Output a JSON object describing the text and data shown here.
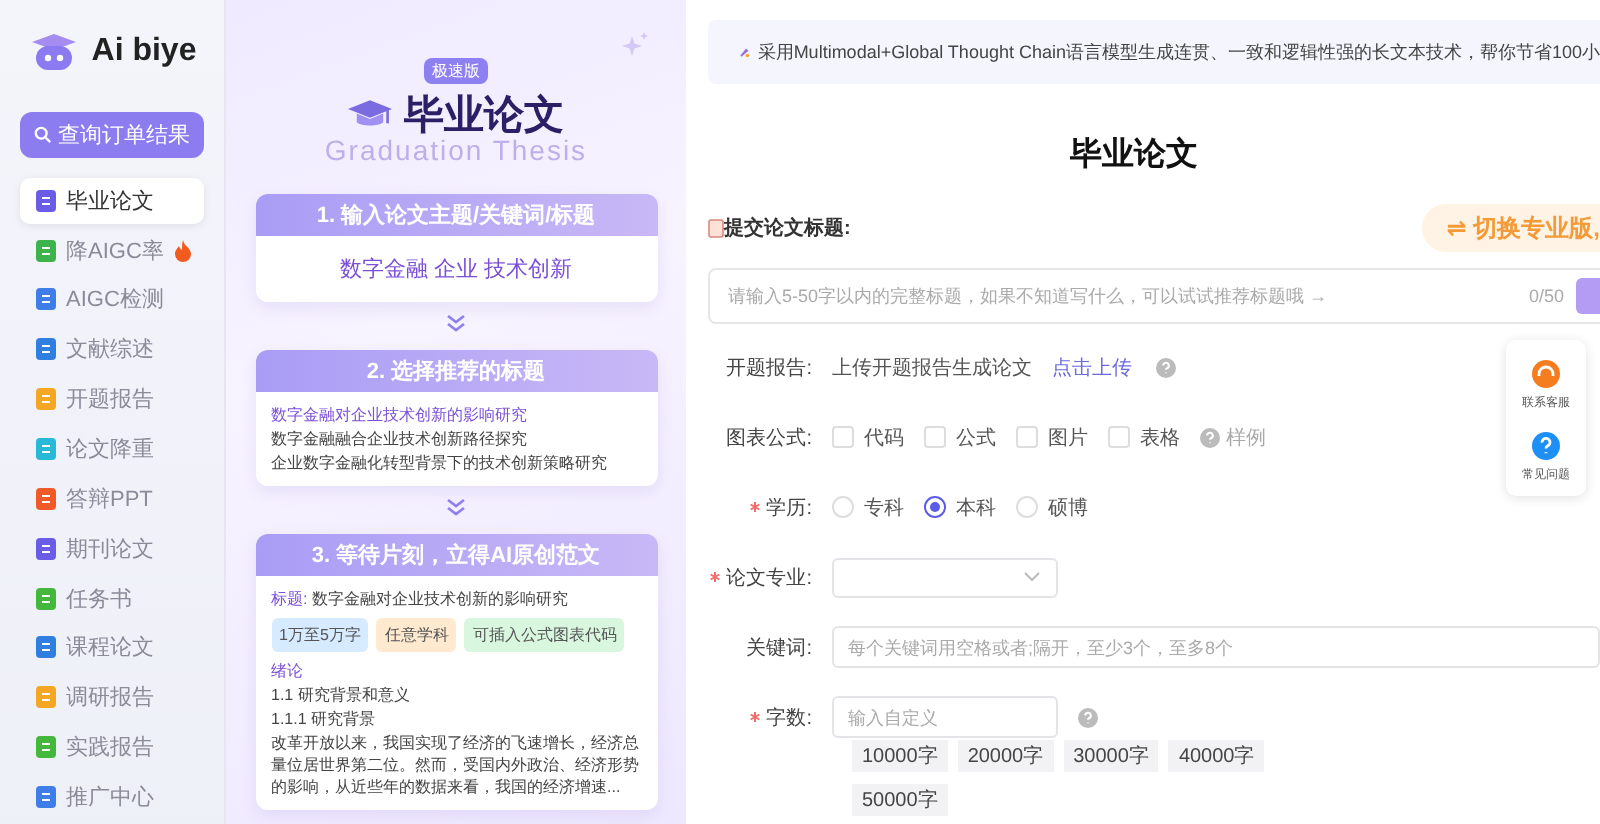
{
  "brand": {
    "name": "Ai biye"
  },
  "sidebar": {
    "search_button": "查询订单结果",
    "items": [
      {
        "label": "毕业论文",
        "selected": true,
        "color": "#6b5ce7",
        "hot": false
      },
      {
        "label": "降AIGC率",
        "selected": false,
        "color": "#3cb44b",
        "hot": true
      },
      {
        "label": "AIGC检测",
        "selected": false,
        "color": "#3f7de8",
        "hot": false
      },
      {
        "label": "文献综述",
        "selected": false,
        "color": "#2f7fe0",
        "hot": false
      },
      {
        "label": "开题报告",
        "selected": false,
        "color": "#f5a623",
        "hot": false
      },
      {
        "label": "论文降重",
        "selected": false,
        "color": "#28b8d8",
        "hot": false
      },
      {
        "label": "答辩PPT",
        "selected": false,
        "color": "#ef5a28",
        "hot": false
      },
      {
        "label": "期刊论文",
        "selected": false,
        "color": "#6b5ce7",
        "hot": false
      },
      {
        "label": "任务书",
        "selected": false,
        "color": "#43b83c",
        "hot": false
      },
      {
        "label": "课程论文",
        "selected": false,
        "color": "#2f7fe0",
        "hot": false
      },
      {
        "label": "调研报告",
        "selected": false,
        "color": "#f5a623",
        "hot": false
      },
      {
        "label": "实践报告",
        "selected": false,
        "color": "#43b83c",
        "hot": false
      },
      {
        "label": "推广中心",
        "selected": false,
        "color": "#3f7de8",
        "hot": false
      }
    ]
  },
  "promo": {
    "badge": "极速版",
    "title": "毕业论文",
    "subtitle": "Graduation Thesis",
    "steps": [
      {
        "kind": "keywords",
        "header": "1. 输入论文主题/关键词/标题",
        "text": "数字金融 企业 技术创新"
      },
      {
        "kind": "titles",
        "header": "2. 选择推荐的标题",
        "lines": [
          {
            "text": "数字金融对企业技术创新的影响研究",
            "selected": true
          },
          {
            "text": "数字金融融合企业技术创新路径探究",
            "selected": false
          },
          {
            "text": "企业数字金融化转型背景下的技术创新策略研究",
            "selected": false
          }
        ]
      },
      {
        "kind": "sample",
        "header": "3. 等待片刻，立得AI原创范文",
        "title_label": "标题:",
        "title": "数字金融对企业技术创新的影响研究",
        "tags": [
          {
            "text": "1万至5万字",
            "color": "#d6ebff"
          },
          {
            "text": "任意学科",
            "color": "#ffe9cf"
          },
          {
            "text": "可插入公式图表代码",
            "color": "#d9f7df"
          }
        ],
        "section": "绪论",
        "lines": [
          "1.1 研究背景和意义",
          "1.1.1 研究背景"
        ],
        "paragraph": "改革开放以来，我国实现了经济的飞速增长，经济总量位居世界第二位。然而，受国内外政治、经济形势的影响，从近些年的数据来看，我国的经济增速..."
      }
    ]
  },
  "main": {
    "banner": "采用Multimodal+Global Thought Chain语言模型生成连贯、一致和逻辑性强的长文本技术，帮你节省100小",
    "title": "毕业论文",
    "title_label": "提交论文标题:",
    "switch_button": "⇌ 切换专业版,",
    "title_input": {
      "placeholder": "请输入5-50字以内的完整标题，如果不知道写什么，可以试试推荐标题哦 →",
      "counter": "0/50"
    },
    "proposal": {
      "label": "开题报告:",
      "text": "上传开题报告生成论文",
      "link": "点击上传"
    },
    "charts": {
      "label": "图表公式:",
      "options": [
        {
          "label": "代码",
          "checked": false
        },
        {
          "label": "公式",
          "checked": false
        },
        {
          "label": "图片",
          "checked": false
        },
        {
          "label": "表格",
          "checked": false
        }
      ],
      "example": "样例"
    },
    "degree": {
      "label": "学历:",
      "required": true,
      "options": [
        {
          "label": "专科",
          "selected": false
        },
        {
          "label": "本科",
          "selected": true
        },
        {
          "label": "硕博",
          "selected": false
        }
      ]
    },
    "major": {
      "label": "论文专业:",
      "required": true
    },
    "keywords": {
      "label": "关键词:",
      "required": false,
      "placeholder": "每个关键词用空格或者;隔开，至少3个，至多8个"
    },
    "words": {
      "label": "字数:",
      "required": true,
      "placeholder": "输入自定义",
      "chips": [
        "10000字",
        "20000字",
        "30000字",
        "40000字",
        "50000字"
      ]
    }
  },
  "float_panel": [
    {
      "kind": "service",
      "label": "联系客服"
    },
    {
      "kind": "faq",
      "label": "常见问题"
    }
  ]
}
